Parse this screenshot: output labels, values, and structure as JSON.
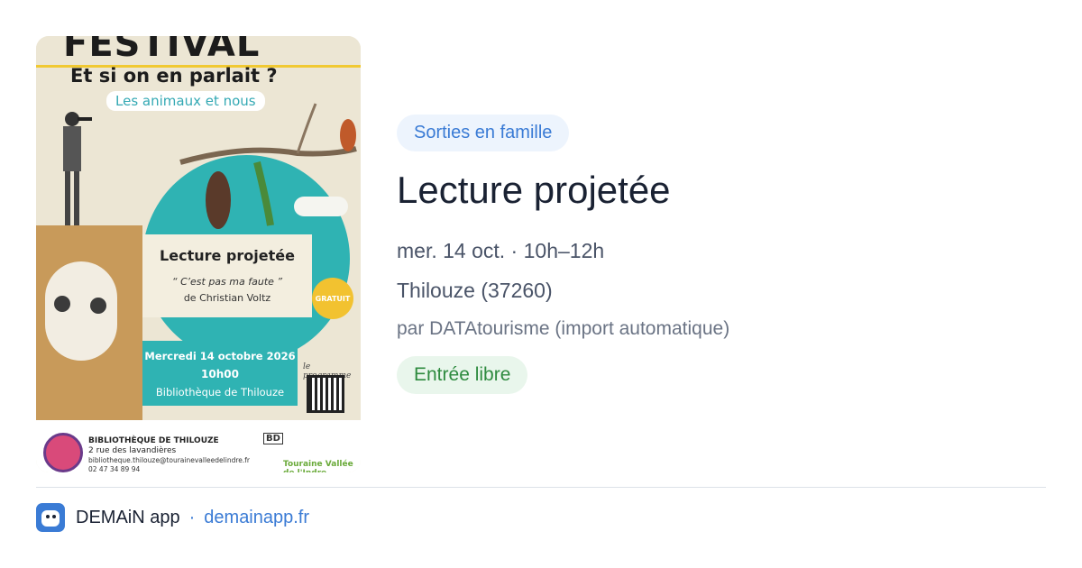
{
  "poster": {
    "festival": "FESTIVAL",
    "headline": "Et si on en parlait ?",
    "theme": "Les animaux et nous",
    "event_title": "Lecture projetée",
    "book_quote": "“ C’est pas ma faute ”",
    "book_author": "de Christian Voltz",
    "free_label": "GRATUIT",
    "date": "Mercredi 14 octobre 2026",
    "time": "10h00",
    "place": "Bibliothèque de Thilouze",
    "program_label": "le programme",
    "library_name": "BIBLIOTHÈQUE DE THILOUZE",
    "library_address": "2 rue des lavandières",
    "library_email": "bibliotheque.thilouze@tourainevalleedelindre.fr",
    "library_phone": "02 47 34 89 94",
    "partner_bd": "BD",
    "partner_touraine": "Touraine Vallée de l'Indre"
  },
  "event": {
    "category": "Sorties en famille",
    "title": "Lecture projetée",
    "when": "mer. 14 oct. · 10h–12h",
    "where": "Thilouze (37260)",
    "source": "par DATAtourisme (import automatique)",
    "price": "Entrée libre"
  },
  "footer": {
    "app_name": "DEMAiN app",
    "separator": "·",
    "domain": "demainapp.fr"
  },
  "colors": {
    "accent": "#3a7bd5",
    "category_bg": "#edf4fd",
    "free_bg": "#e9f6ec",
    "free_text": "#2e8b3f",
    "poster_teal": "#2fb3b3"
  },
  "icons": {
    "app": "demain-app-icon"
  }
}
